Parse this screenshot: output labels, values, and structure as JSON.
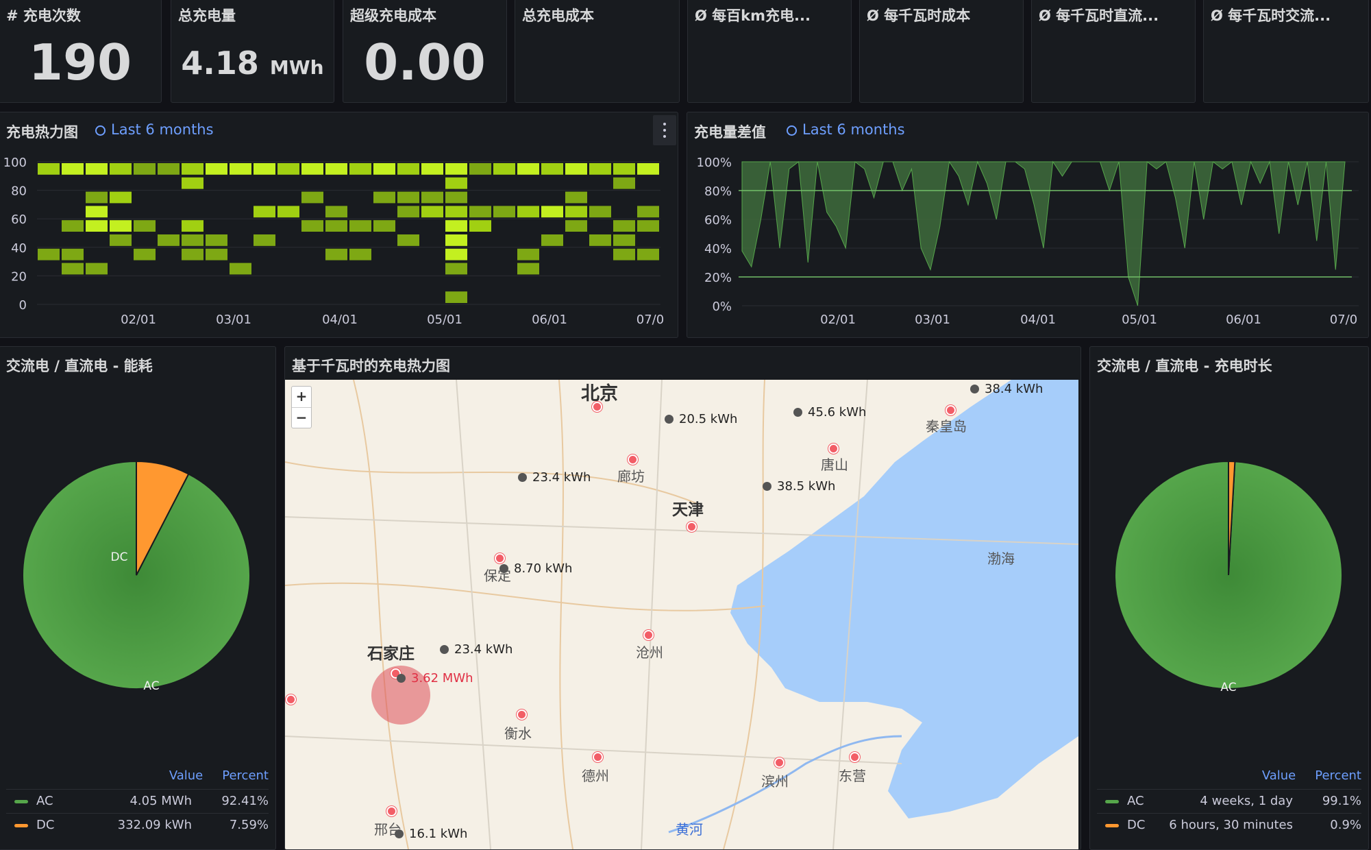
{
  "stats": [
    {
      "title": "# 充电次数",
      "value": "190",
      "unit": ""
    },
    {
      "title": "总充电量",
      "value": "4.18",
      "unit": "MWh"
    },
    {
      "title": "超级充电成本",
      "value": "0.00",
      "unit": ""
    },
    {
      "title": "总充电成本",
      "value": "",
      "unit": ""
    },
    {
      "title": "Ø 每百km充电...",
      "value": "",
      "unit": ""
    },
    {
      "title": "Ø 每千瓦时成本",
      "value": "",
      "unit": ""
    },
    {
      "title": "Ø 每千瓦时直流...",
      "value": "",
      "unit": ""
    },
    {
      "title": "Ø 每千瓦时交流...",
      "value": "",
      "unit": ""
    }
  ],
  "heatmap_panel": {
    "title": "充电热力图",
    "range": "Last 6 months"
  },
  "diff_panel": {
    "title": "充电量差值",
    "range": "Last 6 months"
  },
  "energy_panel": {
    "title": "交流电 / 直流电 - 能耗",
    "legend_value": "Value",
    "legend_percent": "Percent",
    "rows": [
      {
        "name": "AC",
        "value": "4.05 MWh",
        "percent": "92.41%",
        "color": "#56a64b"
      },
      {
        "name": "DC",
        "value": "332.09 kWh",
        "percent": "7.59%",
        "color": "#ff9830"
      }
    ]
  },
  "map_panel": {
    "title": "基于千瓦时的充电热力图",
    "zoom_in": "+",
    "zoom_out": "−",
    "markers": [
      "38.4 kWh",
      "45.6 kWh",
      "20.5 kWh",
      "23.4 kWh",
      "38.5 kWh",
      "8.70 kWh",
      "23.4 kWh",
      "3.62 MWh",
      "16.1 kWh"
    ],
    "cities": [
      "北京",
      "秦皇岛",
      "唐山",
      "廊坊",
      "天津",
      "渤海",
      "保定",
      "石家庄",
      "沧州",
      "衡水",
      "德州",
      "滨州",
      "东营",
      "邢台",
      "黄河"
    ]
  },
  "duration_panel": {
    "title": "交流电 / 直流电 - 充电时长",
    "legend_value": "Value",
    "legend_percent": "Percent",
    "rows": [
      {
        "name": "AC",
        "value": "4 weeks, 1 day",
        "percent": "99.1%",
        "color": "#56a64b"
      },
      {
        "name": "DC",
        "value": "6 hours, 30 minutes",
        "percent": "0.9%",
        "color": "#ff9830"
      }
    ]
  },
  "chart_data": [
    {
      "type": "heatmap",
      "title": "充电热力图",
      "yticks": [
        "100",
        "80",
        "60",
        "40",
        "20",
        "0"
      ],
      "xticks": [
        "02/01",
        "03/01",
        "04/01",
        "05/01",
        "06/01",
        "07/0"
      ],
      "ylim": [
        0,
        100
      ],
      "columns": 26,
      "rows_top_to_bottom": [
        100,
        90,
        80,
        70,
        60,
        50,
        40,
        30,
        20,
        10,
        0
      ],
      "cells": [
        [
          0,
          0,
          2
        ],
        [
          1,
          0,
          3
        ],
        [
          2,
          0,
          3
        ],
        [
          3,
          0,
          2
        ],
        [
          4,
          0,
          1
        ],
        [
          5,
          0,
          1
        ],
        [
          6,
          0,
          2
        ],
        [
          7,
          0,
          3
        ],
        [
          8,
          0,
          3
        ],
        [
          9,
          0,
          3
        ],
        [
          10,
          0,
          2
        ],
        [
          11,
          0,
          3
        ],
        [
          12,
          0,
          3
        ],
        [
          13,
          0,
          2
        ],
        [
          14,
          0,
          3
        ],
        [
          15,
          0,
          2
        ],
        [
          16,
          0,
          3
        ],
        [
          17,
          0,
          3
        ],
        [
          18,
          0,
          1
        ],
        [
          19,
          0,
          2
        ],
        [
          20,
          0,
          3
        ],
        [
          21,
          0,
          2
        ],
        [
          22,
          0,
          3
        ],
        [
          23,
          0,
          2
        ],
        [
          24,
          0,
          2
        ],
        [
          25,
          0,
          3
        ],
        [
          6,
          1,
          2
        ],
        [
          17,
          1,
          2
        ],
        [
          24,
          1,
          1
        ],
        [
          2,
          2,
          1
        ],
        [
          3,
          2,
          2
        ],
        [
          11,
          2,
          1
        ],
        [
          14,
          2,
          1
        ],
        [
          15,
          2,
          1
        ],
        [
          16,
          2,
          1
        ],
        [
          17,
          2,
          1
        ],
        [
          22,
          2,
          1
        ],
        [
          2,
          3,
          3
        ],
        [
          9,
          3,
          2
        ],
        [
          10,
          3,
          2
        ],
        [
          12,
          3,
          1
        ],
        [
          15,
          3,
          1
        ],
        [
          16,
          3,
          2
        ],
        [
          17,
          3,
          2
        ],
        [
          18,
          3,
          1
        ],
        [
          19,
          3,
          1
        ],
        [
          20,
          3,
          2
        ],
        [
          21,
          3,
          3
        ],
        [
          22,
          3,
          2
        ],
        [
          23,
          3,
          1
        ],
        [
          25,
          3,
          1
        ],
        [
          1,
          4,
          1
        ],
        [
          2,
          4,
          3
        ],
        [
          3,
          4,
          3
        ],
        [
          4,
          4,
          1
        ],
        [
          6,
          4,
          2
        ],
        [
          11,
          4,
          1
        ],
        [
          12,
          4,
          1
        ],
        [
          13,
          4,
          1
        ],
        [
          14,
          4,
          1
        ],
        [
          17,
          4,
          3
        ],
        [
          18,
          4,
          2
        ],
        [
          22,
          4,
          1
        ],
        [
          24,
          4,
          1
        ],
        [
          25,
          4,
          1
        ],
        [
          3,
          5,
          1
        ],
        [
          5,
          5,
          1
        ],
        [
          6,
          5,
          1
        ],
        [
          7,
          5,
          1
        ],
        [
          9,
          5,
          1
        ],
        [
          15,
          5,
          1
        ],
        [
          17,
          5,
          3
        ],
        [
          21,
          5,
          1
        ],
        [
          23,
          5,
          1
        ],
        [
          24,
          5,
          1
        ],
        [
          0,
          6,
          1
        ],
        [
          1,
          6,
          1
        ],
        [
          4,
          6,
          1
        ],
        [
          6,
          6,
          1
        ],
        [
          7,
          6,
          1
        ],
        [
          12,
          6,
          1
        ],
        [
          13,
          6,
          1
        ],
        [
          17,
          6,
          3
        ],
        [
          20,
          6,
          1
        ],
        [
          24,
          6,
          1
        ],
        [
          25,
          6,
          1
        ],
        [
          1,
          7,
          1
        ],
        [
          2,
          7,
          1
        ],
        [
          8,
          7,
          1
        ],
        [
          17,
          7,
          1
        ],
        [
          20,
          7,
          1
        ],
        [
          17,
          9,
          1
        ]
      ]
    },
    {
      "type": "area",
      "title": "充电量差值",
      "yticks": [
        "100%",
        "80%",
        "60%",
        "40%",
        "20%",
        "0%"
      ],
      "xticks": [
        "02/01",
        "03/01",
        "04/01",
        "05/01",
        "06/01",
        "07/0"
      ],
      "ylim": [
        0,
        100
      ],
      "thresholds": [
        80,
        20
      ],
      "values": [
        38,
        27,
        60,
        100,
        40,
        95,
        100,
        30,
        100,
        65,
        55,
        40,
        100,
        95,
        75,
        100,
        100,
        80,
        95,
        40,
        25,
        55,
        100,
        90,
        70,
        100,
        85,
        60,
        100,
        100,
        95,
        70,
        40,
        100,
        90,
        100,
        100,
        100,
        100,
        80,
        100,
        20,
        0,
        100,
        95,
        100,
        75,
        40,
        100,
        60,
        100,
        95,
        100,
        70,
        100,
        85,
        100,
        50,
        100,
        70,
        100,
        45,
        100,
        25,
        100
      ]
    },
    {
      "type": "pie",
      "title": "交流电 / 直流电 - 能耗",
      "categories": [
        "AC",
        "DC"
      ],
      "values": [
        92.41,
        7.59
      ]
    },
    {
      "type": "pie",
      "title": "交流电 / 直流电 - 充电时长",
      "categories": [
        "AC",
        "DC"
      ],
      "values": [
        99.1,
        0.9
      ]
    }
  ]
}
